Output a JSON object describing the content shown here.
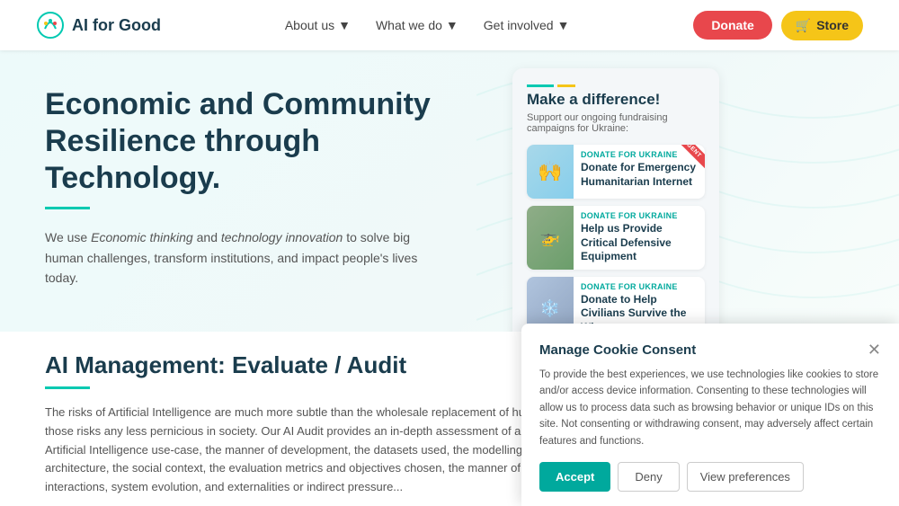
{
  "nav": {
    "logo_text": "AI for Good",
    "links": [
      {
        "label": "About us",
        "has_arrow": true
      },
      {
        "label": "What we do",
        "has_arrow": true
      },
      {
        "label": "Get involved",
        "has_arrow": true
      }
    ],
    "btn_donate": "Donate",
    "btn_store": "Store"
  },
  "hero": {
    "title": "Economic and Community Resilience through Technology.",
    "body_part1": "We use ",
    "body_italic1": "Economic thinking",
    "body_part2": " and ",
    "body_italic2": "technology innovation",
    "body_part3": " to solve big human challenges, transform institutions, and impact people's lives today."
  },
  "donation_card": {
    "title": "Make a difference!",
    "subtitle": "Support our ongoing fundraising campaigns for Ukraine:",
    "items": [
      {
        "label": "Donate for Ukraine",
        "name": "Donate for Emergency Humanitarian Internet",
        "urgent": true,
        "urgent_text": "URGENT",
        "img_type": "hands"
      },
      {
        "label": "Donate for Ukraine",
        "name": "Help us Provide Critical Defensive Equipment",
        "urgent": false,
        "img_type": "drone"
      },
      {
        "label": "Donate for Ukraine",
        "name": "Donate to Help Civilians Survive the Winter",
        "urgent": false,
        "img_type": "winter"
      }
    ]
  },
  "bottom": {
    "title": "AI Management: Evaluate / Audit",
    "body": "The risks of Artificial Intelligence are much more subtle than the wholesale replacement of humans, but that doesn't make those risks any less pernicious in society. Our AI Audit provides an in-depth assessment of a proposed or implemented Artificial Intelligence use-case, the manner of development, the datasets used, the modelling choices, the system architecture, the social context, the evaluation metrics and objectives chosen, the manner of deployment, the stakeholder interactions, system evolution, and externalities or indirect pressure..."
  },
  "cookie": {
    "title": "Manage Cookie Consent",
    "body": "To provide the best experiences, we use technologies like cookies to store and/or access device information. Consenting to these technologies will allow us to process data such as browsing behavior or unique IDs on this site. Not consenting or withdrawing consent, may adversely affect certain features and functions.",
    "btn_accept": "Accept",
    "btn_deny": "Deny",
    "btn_preferences": "View preferences"
  }
}
